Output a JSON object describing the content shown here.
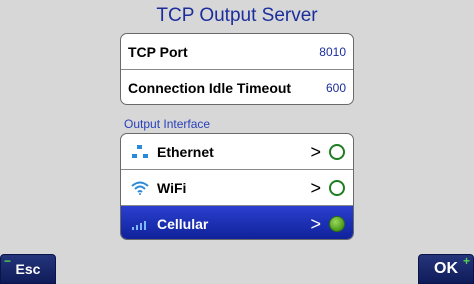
{
  "title": "TCP Output Server",
  "settings": [
    {
      "label": "TCP Port",
      "value": "8010"
    },
    {
      "label": "Connection Idle Timeout",
      "value": "600"
    }
  ],
  "section_label": "Output Interface",
  "interfaces": [
    {
      "label": "Ethernet",
      "icon": "ethernet-icon",
      "chevron": ">",
      "selected": false
    },
    {
      "label": "WiFi",
      "icon": "wifi-icon",
      "chevron": ">",
      "selected": false
    },
    {
      "label": "Cellular",
      "icon": "cellular-icon",
      "chevron": ">",
      "selected": true
    }
  ],
  "softkeys": {
    "esc_label": "Esc",
    "esc_mark": "−",
    "ok_label": "OK",
    "ok_mark": "+"
  },
  "colors": {
    "title": "#1c2e9c",
    "selection": "#1a2fb8",
    "radio_green": "#4c9a1a"
  }
}
